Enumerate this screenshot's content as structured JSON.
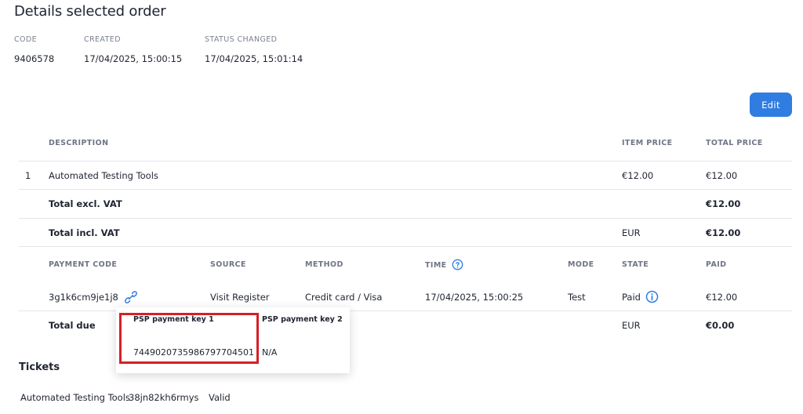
{
  "page": {
    "title": "Details selected order"
  },
  "order": {
    "code_label": "CODE",
    "code": "9406578",
    "created_label": "CREATED",
    "created": "17/04/2025, 15:00:15",
    "status_changed_label": "STATUS CHANGED",
    "status_changed": "17/04/2025, 15:01:14"
  },
  "actions": {
    "edit_label": "Edit"
  },
  "items_table": {
    "headers": {
      "description": "DESCRIPTION",
      "item_price": "ITEM PRICE",
      "total_price": "TOTAL PRICE"
    },
    "rows": [
      {
        "index": "1",
        "description": "Automated Testing Tools",
        "item_price": "€12.00",
        "total_price": "€12.00"
      }
    ],
    "total_excl_vat": {
      "label": "Total excl. VAT",
      "total": "€12.00"
    },
    "total_incl_vat": {
      "label": "Total incl. VAT",
      "currency": "EUR",
      "total": "€12.00"
    }
  },
  "payments_table": {
    "headers": {
      "payment_code": "PAYMENT CODE",
      "source": "SOURCE",
      "method": "METHOD",
      "time": "TIME",
      "mode": "MODE",
      "state": "STATE",
      "paid": "PAID"
    },
    "rows": [
      {
        "payment_code": "3g1k6cm9je1j8",
        "source": "Visit Register",
        "method": "Credit card / Visa",
        "time": "17/04/2025, 15:00:25",
        "mode": "Test",
        "state": "Paid",
        "paid": "€12.00"
      }
    ],
    "total_due": {
      "label": "Total due",
      "currency": "EUR",
      "total": "€0.00"
    }
  },
  "psp_popover": {
    "key1_label": "PSP payment key 1",
    "key1_value": "744902073598679770450​1",
    "key2_label": "PSP payment key 2",
    "key2_value": "N/A"
  },
  "tickets": {
    "title": "Tickets",
    "rows": [
      {
        "name": "Automated Testing Tools",
        "code": "38jn82kh6rmys",
        "status": "Valid"
      }
    ]
  },
  "colors": {
    "accent": "#2f7de1",
    "highlight": "#d71f26",
    "divider": "#e3e5ea"
  },
  "icons": {
    "time_help": "question-circle-icon",
    "state_info": "info-circle-icon",
    "payment_link": "link-icon"
  }
}
